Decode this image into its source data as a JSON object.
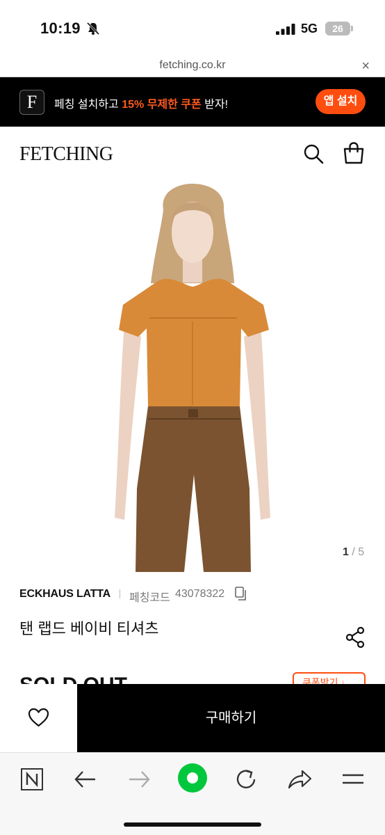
{
  "status_bar": {
    "time": "10:19",
    "network": "5G",
    "battery": "26"
  },
  "url_bar": {
    "domain": "fetching.co.kr",
    "close": "×"
  },
  "promo": {
    "logo_letter": "F",
    "text_before": "페칭 설치하고 ",
    "text_highlight": "15% 무제한 쿠폰",
    "text_after": " 받자!",
    "install_label": "앱 설치",
    "highlight_color": "#ff5a1f"
  },
  "header": {
    "logo": "FETCHING"
  },
  "product": {
    "pager_current": "1",
    "pager_sep": " / ",
    "pager_total": "5",
    "brand": "ECKHAUS LATTA",
    "code_label": "페칭코드",
    "code_value": "43078322",
    "name": "탠 랩드 베이비 티셔츠",
    "status": "SOLD OUT",
    "coupon_label": "쿠폰받기 ↓"
  },
  "buy_bar": {
    "buy_label": "구매하기"
  },
  "colors": {
    "accent": "#ff4d10",
    "dark": "#000000",
    "toolbar": "#f7f7f7",
    "green": "#00c73c"
  },
  "toolbar": {
    "items": [
      "naver-icon",
      "back-icon",
      "forward-icon",
      "green-dot-icon",
      "reload-icon",
      "share-icon",
      "menu-icon"
    ]
  }
}
